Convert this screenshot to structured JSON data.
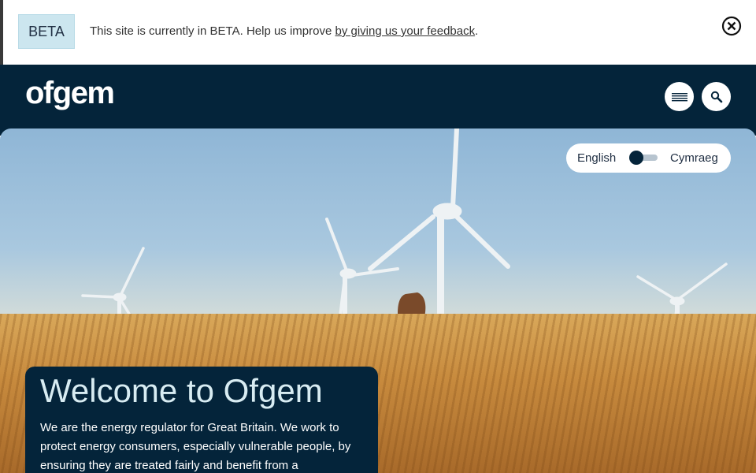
{
  "beta_banner": {
    "tag": "BETA",
    "text_before": "This site is currently in BETA. Help us improve ",
    "link_text": "by giving us your feedback",
    "text_after": ".",
    "close_icon": "close-circle-icon"
  },
  "header": {
    "logo_text": "ofgem",
    "menu_icon": "hamburger-menu-icon",
    "search_icon": "search-icon",
    "background": "#04243a"
  },
  "language_toggle": {
    "left_label": "English",
    "right_label": "Cymraeg",
    "selected": "English"
  },
  "hero": {
    "title": "Welcome to Ofgem",
    "body": "We are the energy regulator for Great Britain. We work to protect energy consumers, especially vulnerable people, by ensuring they are treated fairly and benefit from a"
  }
}
